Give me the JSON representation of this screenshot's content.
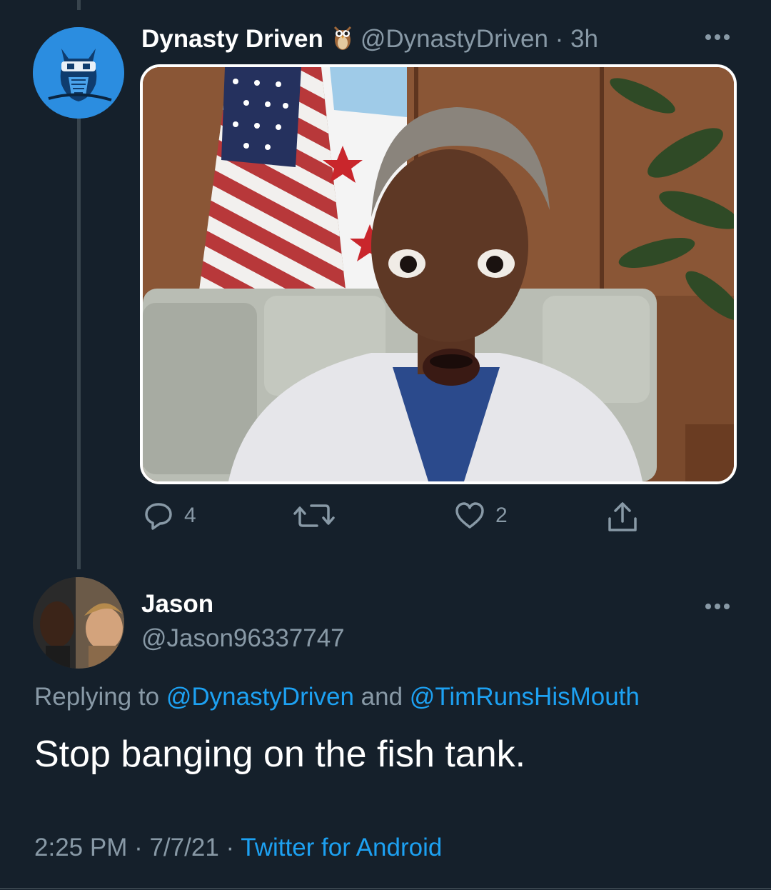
{
  "tweet": {
    "display_name": "Dynasty Driven",
    "name_emoji": "🦉",
    "handle": "@DynastyDriven",
    "separator": " · ",
    "time_ago": "3h",
    "actions": {
      "reply_count": "4",
      "retweet_count": "",
      "like_count": "2"
    }
  },
  "reply": {
    "display_name": "Jason",
    "handle": "@Jason96337747",
    "replying_prefix": "Replying to ",
    "mention_1": "@DynastyDriven",
    "conjunction": " and ",
    "mention_2": "@TimRunsHisMouth",
    "text": "Stop banging on the fish tank.",
    "time": "2:25 PM",
    "dot_1": " · ",
    "date": "7/7/21",
    "dot_2": " · ",
    "client": "Twitter for Android"
  },
  "colors": {
    "background": "#15202b",
    "secondary_text": "#8899a6",
    "link": "#1da1f2",
    "divider": "#38444d"
  },
  "icons": {
    "reply": "reply-icon",
    "retweet": "retweet-icon",
    "like": "heart-icon",
    "share": "share-icon",
    "more": "more-options-icon"
  }
}
